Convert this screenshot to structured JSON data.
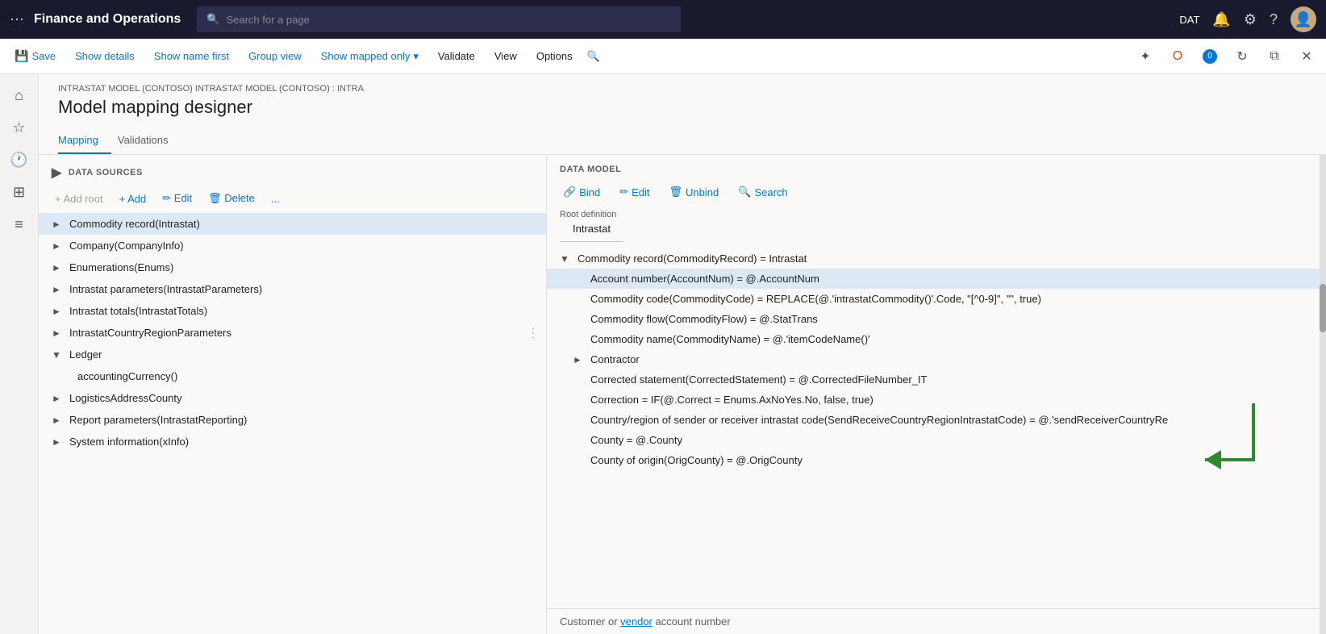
{
  "app": {
    "title": "Finance and Operations",
    "env": "DAT"
  },
  "topnav": {
    "search_placeholder": "Search for a page",
    "notification_icon": "🔔",
    "settings_icon": "⚙",
    "help_icon": "?",
    "badge_count": "0"
  },
  "toolbar": {
    "save_label": "Save",
    "show_details_label": "Show details",
    "show_name_first_label": "Show name first",
    "group_view_label": "Group view",
    "show_mapped_only_label": "Show mapped only",
    "validate_label": "Validate",
    "view_label": "View",
    "options_label": "Options"
  },
  "breadcrumb": "INTRASTAT MODEL (CONTOSO) INTRASTAT MODEL (CONTOSO) : INTRA",
  "page_title": "Model mapping designer",
  "tabs": {
    "mapping_label": "Mapping",
    "validations_label": "Validations"
  },
  "left_panel": {
    "header": "DATA SOURCES",
    "add_root_label": "+ Add root",
    "add_label": "+ Add",
    "edit_label": "✏ Edit",
    "delete_label": "🗑 Delete",
    "more_label": "...",
    "items": [
      {
        "label": "Commodity record(Intrastat)",
        "level": 0,
        "expanded": false,
        "selected": true
      },
      {
        "label": "Company(CompanyInfo)",
        "level": 0,
        "expanded": false,
        "selected": false
      },
      {
        "label": "Enumerations(Enums)",
        "level": 0,
        "expanded": false,
        "selected": false
      },
      {
        "label": "Intrastat parameters(IntrastatParameters)",
        "level": 0,
        "expanded": false,
        "selected": false
      },
      {
        "label": "Intrastat totals(IntrastatTotals)",
        "level": 0,
        "expanded": false,
        "selected": false
      },
      {
        "label": "IntrastatCountryRegionParameters",
        "level": 0,
        "expanded": false,
        "selected": false
      },
      {
        "label": "Ledger",
        "level": 0,
        "expanded": true,
        "selected": false
      },
      {
        "label": "accountingCurrency()",
        "level": 1,
        "expanded": false,
        "selected": false
      },
      {
        "label": "LogisticsAddressCounty",
        "level": 0,
        "expanded": false,
        "selected": false
      },
      {
        "label": "Report parameters(IntrastatReporting)",
        "level": 0,
        "expanded": false,
        "selected": false
      },
      {
        "label": "System information(xInfo)",
        "level": 0,
        "expanded": false,
        "selected": false
      }
    ]
  },
  "right_panel": {
    "header": "DATA MODEL",
    "bind_label": "Bind",
    "edit_label": "Edit",
    "unbind_label": "Unbind",
    "search_label": "Search",
    "root_def_label": "Root definition",
    "root_def_value": "Intrastat",
    "items": [
      {
        "label": "Commodity record(CommodityRecord) = Intrastat",
        "level": 0,
        "expanded": true,
        "selected": false
      },
      {
        "label": "Account number(AccountNum) = @.AccountNum",
        "level": 1,
        "expanded": false,
        "selected": true
      },
      {
        "label": "Commodity code(CommodityCode) = REPLACE(@.'intrastatCommodity()'.Code, \"[^0-9]\", \"\", true)",
        "level": 1,
        "expanded": false,
        "selected": false
      },
      {
        "label": "Commodity flow(CommodityFlow) = @.StatTrans",
        "level": 1,
        "expanded": false,
        "selected": false
      },
      {
        "label": "Commodity name(CommodityName) = @.'itemCodeName()'",
        "level": 1,
        "expanded": false,
        "selected": false
      },
      {
        "label": "Contractor",
        "level": 1,
        "expanded": false,
        "selected": false
      },
      {
        "label": "Corrected statement(CorrectedStatement) = @.CorrectedFileNumber_IT",
        "level": 1,
        "expanded": false,
        "selected": false
      },
      {
        "label": "Correction = IF(@.Correct = Enums.AxNoYes.No, false, true)",
        "level": 1,
        "expanded": false,
        "selected": false
      },
      {
        "label": "Country/region of sender or receiver intrastat code(SendReceiveCountryRegionIntrastatCode) = @.'sendReceiverCountryRe",
        "level": 1,
        "expanded": false,
        "selected": false
      },
      {
        "label": "County = @.County",
        "level": 1,
        "expanded": false,
        "selected": false
      },
      {
        "label": "County of origin(OrigCounty) = @.OrigCounty",
        "level": 1,
        "expanded": false,
        "selected": false
      }
    ],
    "bottom_tooltip": "Customer or vendor account number"
  }
}
